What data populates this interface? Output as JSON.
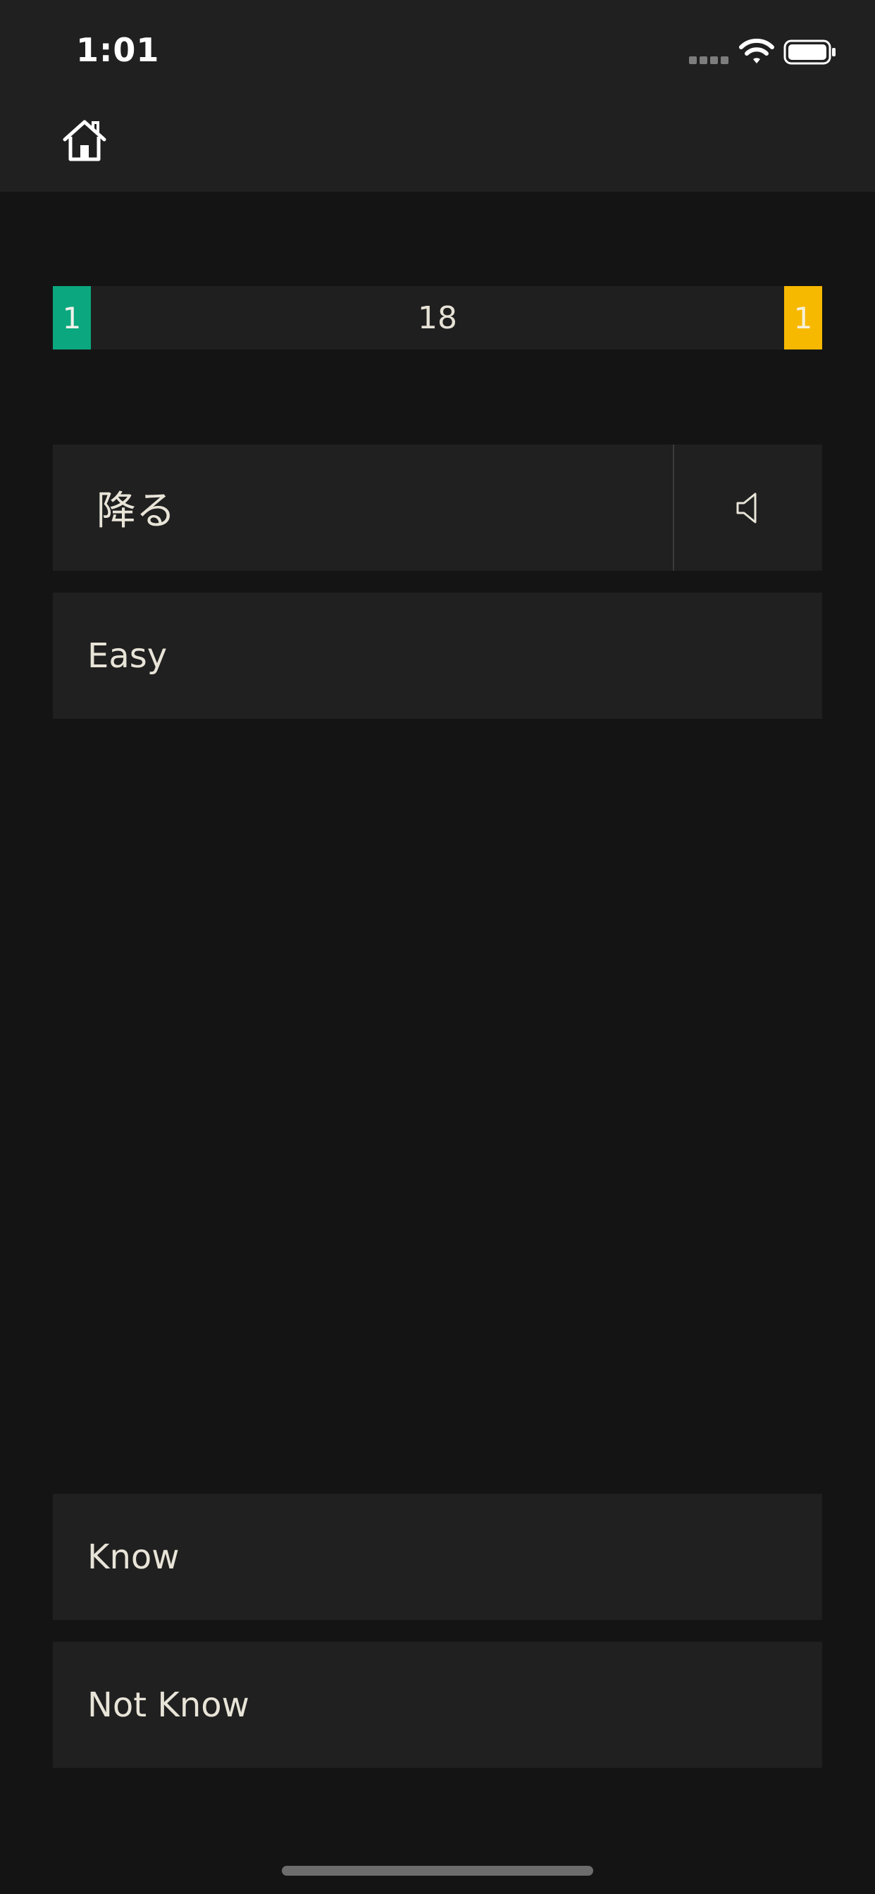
{
  "status_bar": {
    "time": "1:01"
  },
  "nav": {
    "home_icon": "home-icon"
  },
  "progress": {
    "known_count": "1",
    "remaining_count": "18",
    "unknown_count": "1",
    "known_color": "#0ba77e",
    "unknown_color": "#f7b800"
  },
  "card": {
    "word": "降る",
    "audio_icon": "speaker-icon",
    "meaning": "Easy"
  },
  "answers": {
    "know_label": "Know",
    "not_know_label": "Not Know"
  }
}
